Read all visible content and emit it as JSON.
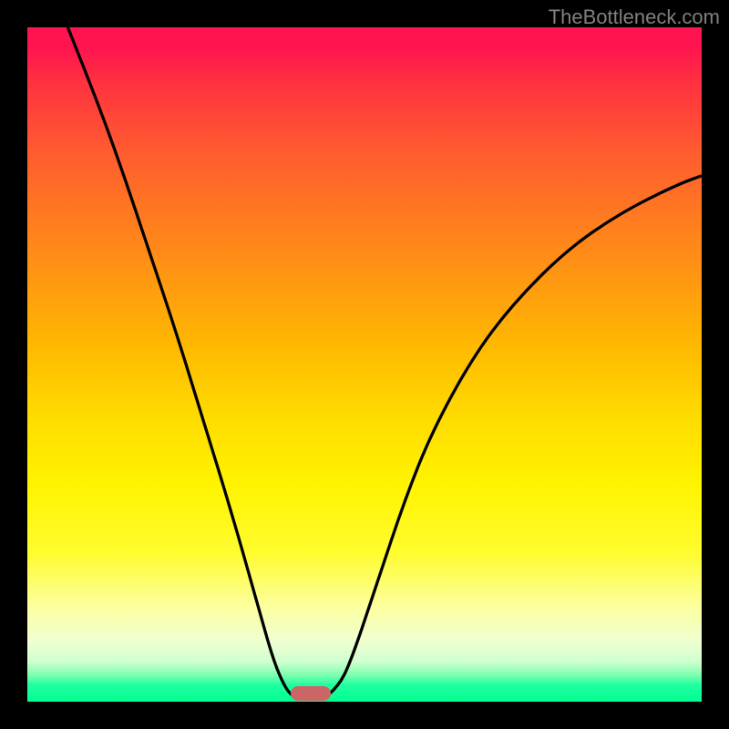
{
  "watermark": "TheBottleneck.com",
  "chart_data": {
    "type": "line",
    "title": "",
    "xlabel": "",
    "ylabel": "",
    "xlim": [
      0,
      100
    ],
    "ylim": [
      0,
      100
    ],
    "grid": false,
    "legend": false,
    "series": [
      {
        "name": "left-curve",
        "x": [
          6,
          10,
          14,
          18,
          22,
          26,
          30,
          34,
          36.5,
          38.5,
          40
        ],
        "y": [
          100,
          90,
          79,
          67,
          55,
          42,
          29,
          15,
          6,
          1.5,
          0.5
        ]
      },
      {
        "name": "right-curve",
        "x": [
          44,
          46,
          48,
          52,
          56,
          60,
          66,
          72,
          80,
          88,
          96,
          100
        ],
        "y": [
          0.5,
          2,
          6,
          18,
          30,
          40,
          51,
          59,
          67,
          72.5,
          76.5,
          78
        ]
      }
    ],
    "marker": {
      "x_center_pct": 42,
      "y_from_bottom_pct": 1.2,
      "color": "#cc6666"
    },
    "gradient_colors": {
      "top": "#ff1450",
      "mid_upper": "#ff9a10",
      "mid": "#ffdc00",
      "mid_lower": "#fcffa0",
      "bottom": "#00ff90"
    },
    "background": "#000000"
  }
}
